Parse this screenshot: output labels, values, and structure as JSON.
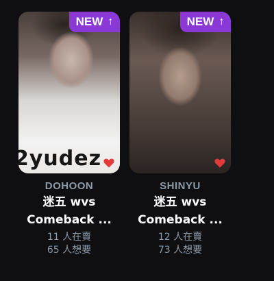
{
  "colors": {
    "background": "#0f0f12",
    "badge": "#8a39d6",
    "heart": "#e23b3b",
    "muted_text": "#8e9aa6"
  },
  "cards": [
    {
      "member": "DOHOON",
      "badge_label": "NEW",
      "badge_icon": "arrow-up-icon",
      "photo_text": "2yudez",
      "title_line1": "迷五 wvs",
      "title_line2": "Comeback ...",
      "selling": "11 人在賣",
      "wanting": "65 人想要",
      "favorited": true
    },
    {
      "member": "SHINYU",
      "badge_label": "NEW",
      "badge_icon": "arrow-up-icon",
      "title_line1": "迷五 wvs",
      "title_line2": "Comeback ...",
      "selling": "12 人在賣",
      "wanting": "73 人想要",
      "favorited": true
    }
  ]
}
